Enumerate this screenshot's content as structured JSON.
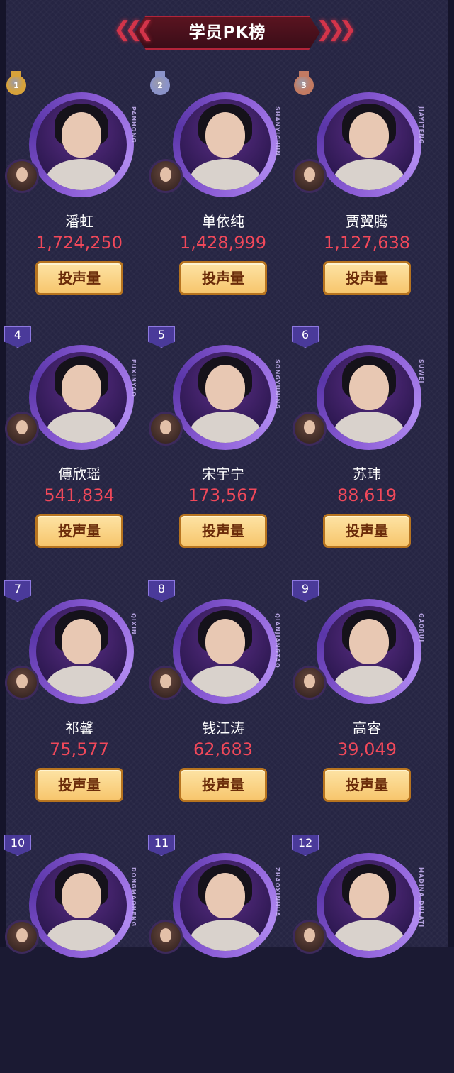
{
  "header": {
    "title": "学员PK榜",
    "left_deco": "❮❮❮",
    "right_deco": "❯❯❯"
  },
  "colors": {
    "accent": "#f0485a",
    "button": "#f7c66d",
    "ring": "#8b5cd6",
    "gold": "#d8a23a",
    "silver": "#8b93c9",
    "bronze": "#c27a62"
  },
  "vote_label": "投声量",
  "contestants": [
    {
      "rank": "1",
      "name": "潘虹",
      "votes": "1,724,250",
      "vname": "PANHONG",
      "badge": "medal-gold"
    },
    {
      "rank": "2",
      "name": "单依纯",
      "votes": "1,428,999",
      "vname": "SHANYICHUN",
      "badge": "medal-silver"
    },
    {
      "rank": "3",
      "name": "贾翼腾",
      "votes": "1,127,638",
      "vname": "JIAYITENG",
      "badge": "medal-bronze"
    },
    {
      "rank": "4",
      "name": "傅欣瑶",
      "votes": "541,834",
      "vname": "FUXINYAO",
      "badge": "flag"
    },
    {
      "rank": "5",
      "name": "宋宇宁",
      "votes": "173,567",
      "vname": "SONGYUNING",
      "badge": "flag"
    },
    {
      "rank": "6",
      "name": "苏玮",
      "votes": "88,619",
      "vname": "SUWEI",
      "badge": "flag"
    },
    {
      "rank": "7",
      "name": "祁馨",
      "votes": "75,577",
      "vname": "QIXIN",
      "badge": "flag"
    },
    {
      "rank": "8",
      "name": "钱江涛",
      "votes": "62,683",
      "vname": "QIANJIANGTAO",
      "badge": "flag"
    },
    {
      "rank": "9",
      "name": "高睿",
      "votes": "39,049",
      "vname": "GAORUI",
      "badge": "flag"
    },
    {
      "rank": "10",
      "name": "",
      "votes": "",
      "vname": "DONGMAOHENG",
      "badge": "flag"
    },
    {
      "rank": "11",
      "name": "",
      "votes": "",
      "vname": "ZHAOXINHUA",
      "badge": "flag"
    },
    {
      "rank": "12",
      "name": "",
      "votes": "",
      "vname": "MADINA-DULATI",
      "badge": "flag"
    }
  ]
}
